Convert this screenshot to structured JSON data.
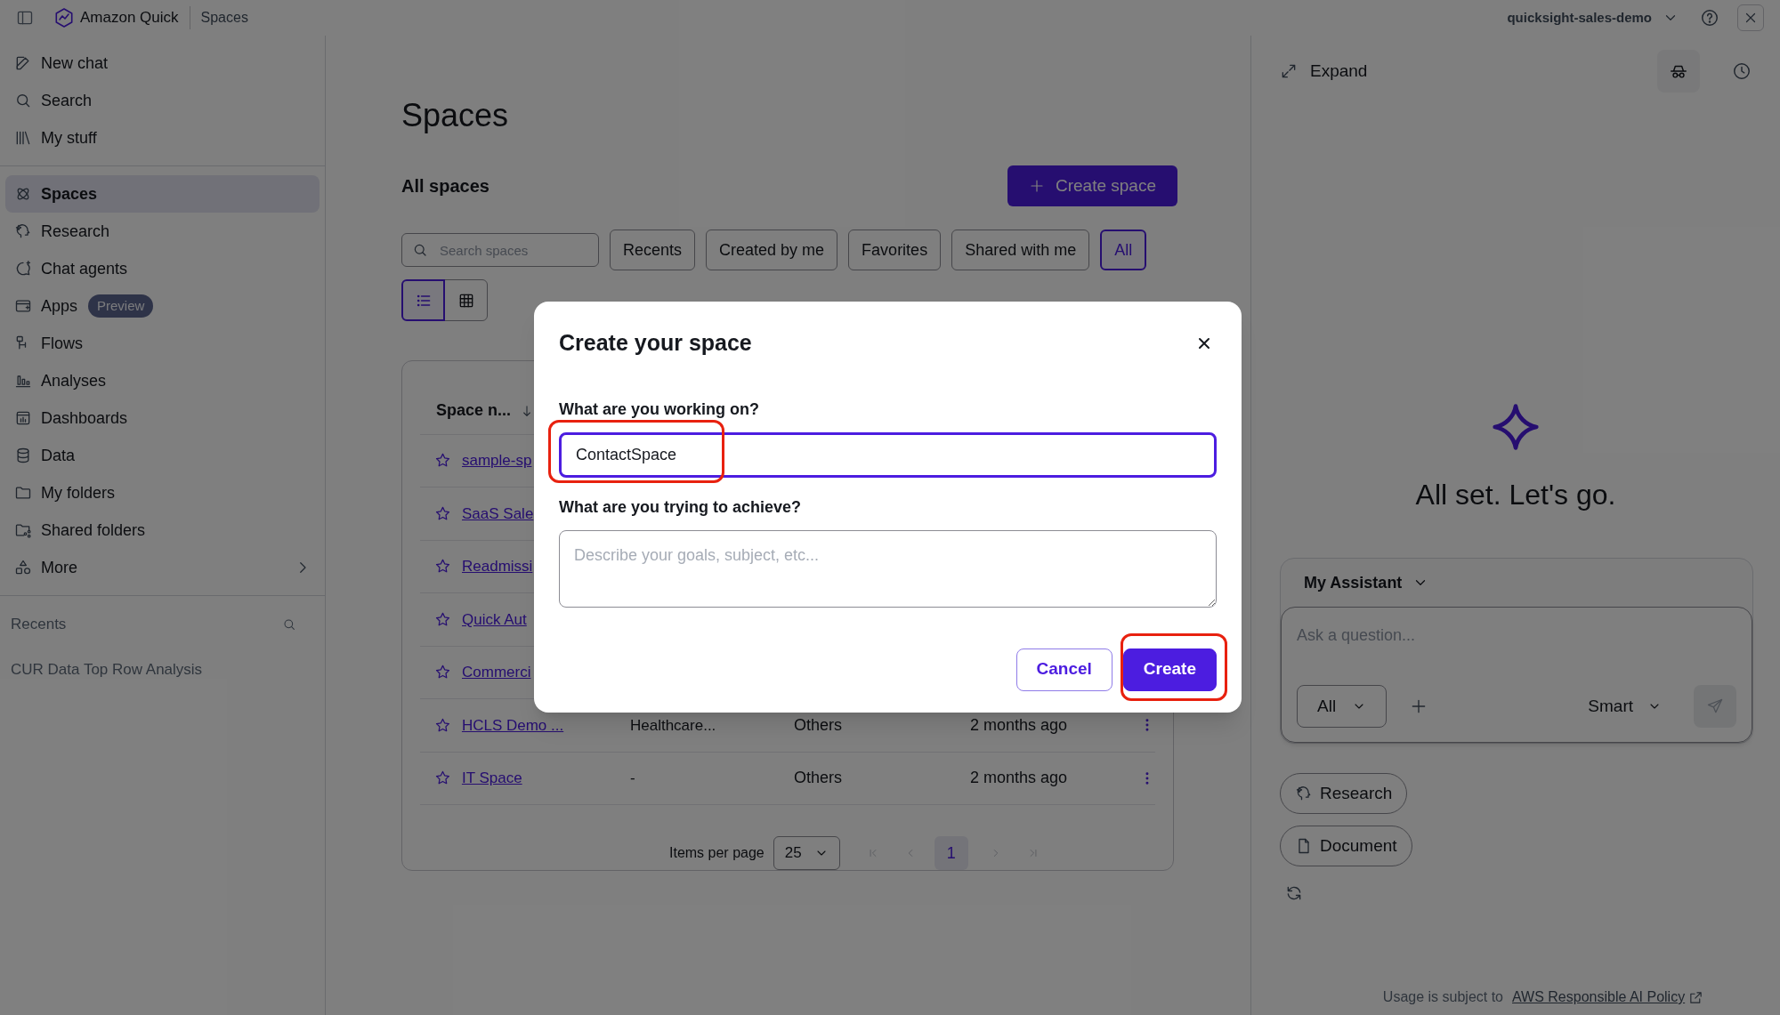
{
  "top_bar": {
    "brand": "Amazon Quick",
    "breadcrumb": "Spaces",
    "account": "quicksight-sales-demo"
  },
  "sidebar": {
    "primary": [
      {
        "label": "New chat"
      },
      {
        "label": "Search"
      },
      {
        "label": "My stuff"
      }
    ],
    "items": [
      {
        "label": "Spaces",
        "selected": true,
        "kind": "link"
      },
      {
        "label": "Research",
        "selected": false,
        "kind": "link"
      },
      {
        "label": "Chat agents",
        "selected": false,
        "kind": "link"
      },
      {
        "label": "Apps",
        "selected": false,
        "kind": "link",
        "badge": "Preview"
      },
      {
        "label": "Flows",
        "selected": false,
        "kind": "link"
      },
      {
        "label": "Analyses",
        "selected": false,
        "kind": "link"
      },
      {
        "label": "Dashboards",
        "selected": false,
        "kind": "link"
      },
      {
        "label": "Data",
        "selected": false,
        "kind": "link"
      },
      {
        "label": "My folders",
        "selected": false,
        "kind": "link"
      },
      {
        "label": "Shared folders",
        "selected": false,
        "kind": "link"
      },
      {
        "label": "More",
        "selected": false,
        "kind": "submenu"
      }
    ],
    "recents": {
      "title": "Recents",
      "items": [
        "CUR Data Top Row Analysis"
      ]
    }
  },
  "page": {
    "title": "Spaces",
    "subtitle": "All spaces",
    "create_button": "Create space",
    "search": {
      "placeholder": "Search spaces"
    },
    "filters": [
      {
        "label": "Recents",
        "selected": false
      },
      {
        "label": "Created by me",
        "selected": false
      },
      {
        "label": "Favorites",
        "selected": false
      },
      {
        "label": "Shared with me",
        "selected": false
      },
      {
        "label": "All",
        "selected": true
      }
    ],
    "views": [
      {
        "selected": true
      },
      {
        "selected": false
      }
    ]
  },
  "table": {
    "columns": [
      "Space n..."
    ],
    "rows": [
      {
        "name": "sample-sp"
      },
      {
        "name": "SaaS Sale"
      },
      {
        "name": "Readmissi"
      },
      {
        "name": "Quick Aut"
      },
      {
        "name": "Commerci"
      },
      {
        "name": "HCLS Demo ...",
        "column_2": "Healthcare...",
        "column_3": "Others",
        "column_4": "2 months ago"
      },
      {
        "name": "IT Space",
        "column_2": "-",
        "column_3": "Others",
        "column_4": "2 months ago"
      }
    ]
  },
  "pagination": {
    "label": "Items per page",
    "page_size": "25",
    "pages": [
      {
        "label": "1",
        "selected": true
      }
    ]
  },
  "modal": {
    "title": "Create your space",
    "fields": [
      {
        "label": "What are you working on?",
        "value": "ContactSpace",
        "focused": true
      },
      {
        "label": "What are you trying to achieve?",
        "placeholder": "Describe your goals, subject, etc...",
        "focused": false
      }
    ],
    "buttons": [
      {
        "label": "Cancel",
        "kind": "secondary"
      },
      {
        "label": "Create",
        "kind": "primary"
      }
    ]
  },
  "assistant": {
    "expand": "Expand",
    "greeting": "All set. Let's go.",
    "agent": "My Assistant",
    "input": {
      "placeholder": "Ask a question..."
    },
    "scope": "All",
    "mode": "Smart",
    "actions": [
      "Research",
      "Document"
    ],
    "footer": {
      "text": "Usage is subject to",
      "link": "AWS Responsible AI Policy"
    }
  }
}
